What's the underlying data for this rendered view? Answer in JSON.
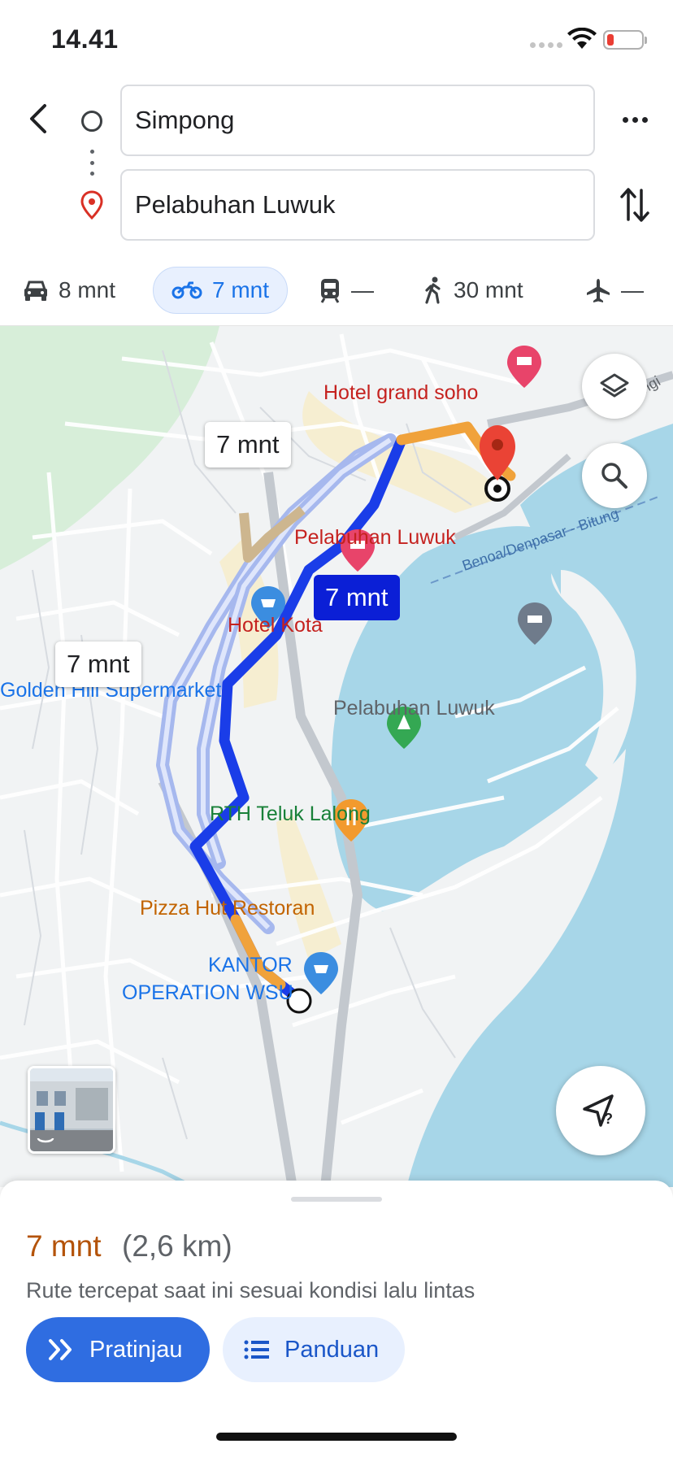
{
  "status_bar": {
    "time": "14.41"
  },
  "search": {
    "origin": "Simpong",
    "destination": "Pelabuhan Luwuk"
  },
  "modes": [
    {
      "mode": "car",
      "icon": "car-icon",
      "label": "8 mnt"
    },
    {
      "mode": "motorcycle",
      "icon": "motorcycle-icon",
      "label": "7 mnt",
      "selected": true
    },
    {
      "mode": "transit",
      "icon": "train-icon",
      "label": "—"
    },
    {
      "mode": "walk",
      "icon": "walking-icon",
      "label": "30 mnt"
    },
    {
      "mode": "flight",
      "icon": "airplane-icon",
      "label": "—"
    }
  ],
  "map": {
    "route_bubbles": {
      "alt_top": "7 mnt",
      "selected": "7 mnt",
      "alt_left": "7 mnt"
    },
    "pois": {
      "hotel_grand_soho": "Hotel grand soho",
      "destination_label": "Pelabuhan Luwuk",
      "hotel_kota": "Hotel Kota",
      "golden_hill": "Golden Hill Supermarket",
      "harbor": "Pelabuhan Luwuk",
      "rth": "RTH Teluk Lalong",
      "pizza_hut": "Pizza Hut Restoran",
      "kantor_line1": "KANTOR",
      "kantor_line2": "OPERATION WSU"
    },
    "road_labels": {
      "ferry": "Benoa/Denpasar - Bitung",
      "edge": "ratulangi"
    },
    "colors": {
      "route_selected": "#1a3de8",
      "route_alt": "#a6b8ee",
      "traffic_slow": "#f0a23b",
      "water": "#a7d6e8",
      "destination_pin": "#ea4335"
    }
  },
  "sheet": {
    "eta": "7 mnt",
    "distance": "(2,6 km)",
    "description": "Rute tercepat saat ini sesuai kondisi lalu lintas",
    "preview_label": "Pratinjau",
    "guide_label": "Panduan"
  }
}
